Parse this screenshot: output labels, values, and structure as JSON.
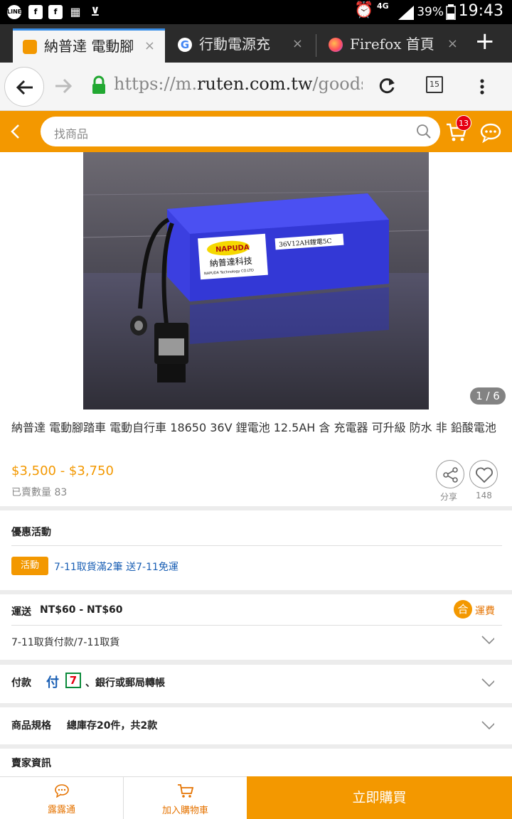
{
  "status_bar": {
    "battery": "39%",
    "time": "19:43",
    "network": "4G"
  },
  "tabs": [
    {
      "label": "納普達 電動腳",
      "active": true
    },
    {
      "label": "行動電源充",
      "active": false
    },
    {
      "label": "Firefox 首頁",
      "active": false
    }
  ],
  "toolbar": {
    "url_prefix": "https://m.",
    "url_host": "ruten.com.tw",
    "url_path": "/goods/",
    "tab_count": "15"
  },
  "header": {
    "search_placeholder": "找商品",
    "cart_count": "13"
  },
  "product": {
    "image_counter": "1 / 6",
    "label_brand": "NAPUDA",
    "label_cn": "納普達科技",
    "label_en": "NAPUDA Technology CO.LTD",
    "label_spec": "36V12AH鋰電5C",
    "title": "納普達 電動腳踏車 電動自行車 18650 36V 鋰電池 12.5AH 含 充電器 可升級 防水 非 鉛酸電池",
    "price": "$3,500 - $3,750",
    "sold": "已賣數量 83",
    "share_label": "分享",
    "like_count": "148"
  },
  "promotion": {
    "title": "優惠活動",
    "badge": "活動",
    "text": "7-11取貨滿2筆 送7-11免運"
  },
  "shipping": {
    "title": "運送",
    "cost": "NT$60 - NT$60",
    "fee_label": "運費",
    "method": "7-11取貨付款/7-11取貨"
  },
  "payment": {
    "title": "付款",
    "methods": "、銀行或郵局轉帳"
  },
  "spec": {
    "title": "商品規格",
    "summary": "總庫存20件，共2款"
  },
  "seller": {
    "title": "賣家資訊"
  },
  "bottom_bar": {
    "chat_label": "露露通",
    "cart_label": "加入購物車",
    "buy_label": "立即購買"
  },
  "colors": {
    "accent": "#f39800",
    "badge": "#e60012",
    "link": "#1a5fb4"
  }
}
